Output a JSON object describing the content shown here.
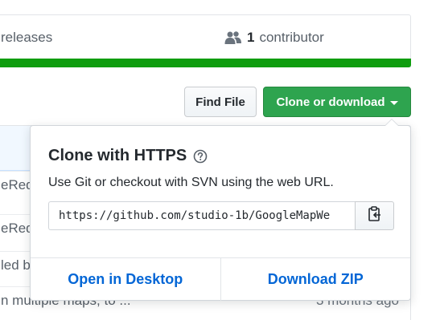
{
  "summary": {
    "releases_label": "releases",
    "contributors_count": "1",
    "contributors_label": "contributor",
    "language_bar_color": "#0f9d0f"
  },
  "file_nav": {
    "find_file_label": "Find File",
    "clone_label": "Clone or download"
  },
  "file_rows": [
    {
      "text": "eReq",
      "age": ""
    },
    {
      "text": "eReq",
      "age": ""
    },
    {
      "text": "led b",
      "age": ""
    },
    {
      "text": "n multiple maps, to ...",
      "age": "3 months ago"
    }
  ],
  "clone_popup": {
    "title": "Clone with HTTPS",
    "help_icon": "question-circle-icon",
    "description": "Use Git or checkout with SVN using the web URL.",
    "url": "https://github.com/studio-1b/GoogleMapWe",
    "copy_icon": "clippy-icon",
    "open_desktop_label": "Open in Desktop",
    "download_zip_label": "Download ZIP"
  },
  "colors": {
    "primary_green": "#2ea44f",
    "link_blue": "#0366d6"
  }
}
